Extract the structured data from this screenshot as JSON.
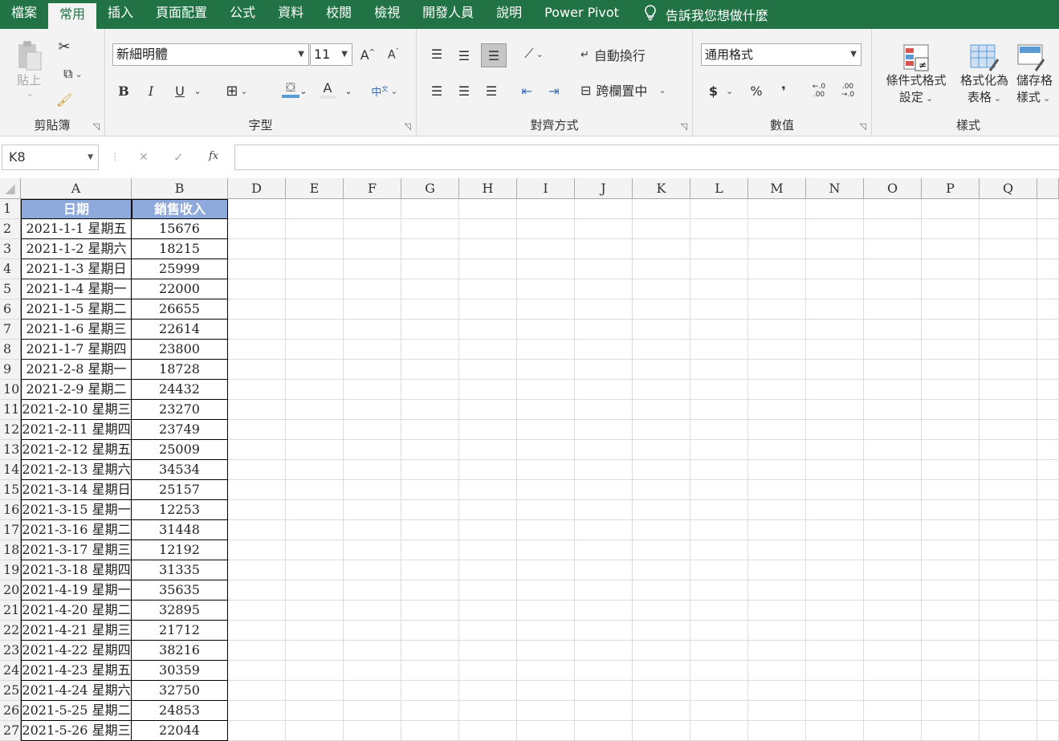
{
  "tabs": [
    "檔案",
    "常用",
    "插入",
    "頁面配置",
    "公式",
    "資料",
    "校閱",
    "檢視",
    "開發人員",
    "說明",
    "Power Pivot"
  ],
  "active_tab": "常用",
  "tell_me": "告訴我您想做什麼",
  "ribbon": {
    "clipboard": {
      "label": "剪貼簿",
      "paste": "貼上"
    },
    "font": {
      "label": "字型",
      "font_name": "新細明體",
      "font_size": "11",
      "bold": "B",
      "italic": "I",
      "underline": "U"
    },
    "alignment": {
      "label": "對齊方式",
      "wrap_text": "自動換行",
      "merge_center": "跨欄置中"
    },
    "number": {
      "label": "數值",
      "format": "通用格式",
      "currency": "$",
      "percent": "%",
      "comma": "❜",
      "inc_decimal": "←.0 .00",
      "dec_decimal": ".00 →.0"
    },
    "styles": {
      "label": "樣式",
      "conditional_format": [
        "條件式格式",
        "設定"
      ],
      "format_as_table": [
        "格式化為",
        "表格"
      ],
      "cell_styles": [
        "儲存格",
        "樣式"
      ]
    }
  },
  "formula_bar": {
    "name_box": "K8",
    "cancel": "✕",
    "enter": "✓",
    "fx": "fx",
    "formula": ""
  },
  "columns": [
    "A",
    "B",
    "D",
    "E",
    "F",
    "G",
    "H",
    "I",
    "J",
    "K",
    "L",
    "M",
    "N",
    "O",
    "P",
    "Q"
  ],
  "headers": {
    "date": "日期",
    "revenue": "銷售收入"
  },
  "rows": [
    {
      "n": "1",
      "a": "日期",
      "b": "銷售收入"
    },
    {
      "n": "2",
      "a": "2021-1-1 星期五",
      "b": "15676"
    },
    {
      "n": "3",
      "a": "2021-1-2 星期六",
      "b": "18215"
    },
    {
      "n": "4",
      "a": "2021-1-3 星期日",
      "b": "25999"
    },
    {
      "n": "5",
      "a": "2021-1-4 星期一",
      "b": "22000"
    },
    {
      "n": "6",
      "a": "2021-1-5 星期二",
      "b": "26655"
    },
    {
      "n": "7",
      "a": "2021-1-6 星期三",
      "b": "22614"
    },
    {
      "n": "8",
      "a": "2021-1-7 星期四",
      "b": "23800"
    },
    {
      "n": "9",
      "a": "2021-2-8 星期一",
      "b": "18728"
    },
    {
      "n": "10",
      "a": "2021-2-9 星期二",
      "b": "24432"
    },
    {
      "n": "11",
      "a": "2021-2-10 星期三",
      "b": "23270"
    },
    {
      "n": "12",
      "a": "2021-2-11 星期四",
      "b": "23749"
    },
    {
      "n": "13",
      "a": "2021-2-12 星期五",
      "b": "25009"
    },
    {
      "n": "14",
      "a": "2021-2-13 星期六",
      "b": "34534"
    },
    {
      "n": "15",
      "a": "2021-3-14 星期日",
      "b": "25157"
    },
    {
      "n": "16",
      "a": "2021-3-15 星期一",
      "b": "12253"
    },
    {
      "n": "17",
      "a": "2021-3-16 星期二",
      "b": "31448"
    },
    {
      "n": "18",
      "a": "2021-3-17 星期三",
      "b": "12192"
    },
    {
      "n": "19",
      "a": "2021-3-18 星期四",
      "b": "31335"
    },
    {
      "n": "20",
      "a": "2021-4-19 星期一",
      "b": "35635"
    },
    {
      "n": "21",
      "a": "2021-4-20 星期二",
      "b": "32895"
    },
    {
      "n": "22",
      "a": "2021-4-21 星期三",
      "b": "21712"
    },
    {
      "n": "23",
      "a": "2021-4-22 星期四",
      "b": "38216"
    },
    {
      "n": "24",
      "a": "2021-4-23 星期五",
      "b": "30359"
    },
    {
      "n": "25",
      "a": "2021-4-24 星期六",
      "b": "32750"
    },
    {
      "n": "26",
      "a": "2021-5-25 星期二",
      "b": "24853"
    },
    {
      "n": "27",
      "a": "2021-5-26 星期三",
      "b": "22044"
    }
  ],
  "colors": {
    "accent": "#217346",
    "header_fill": "#8ea9db"
  }
}
